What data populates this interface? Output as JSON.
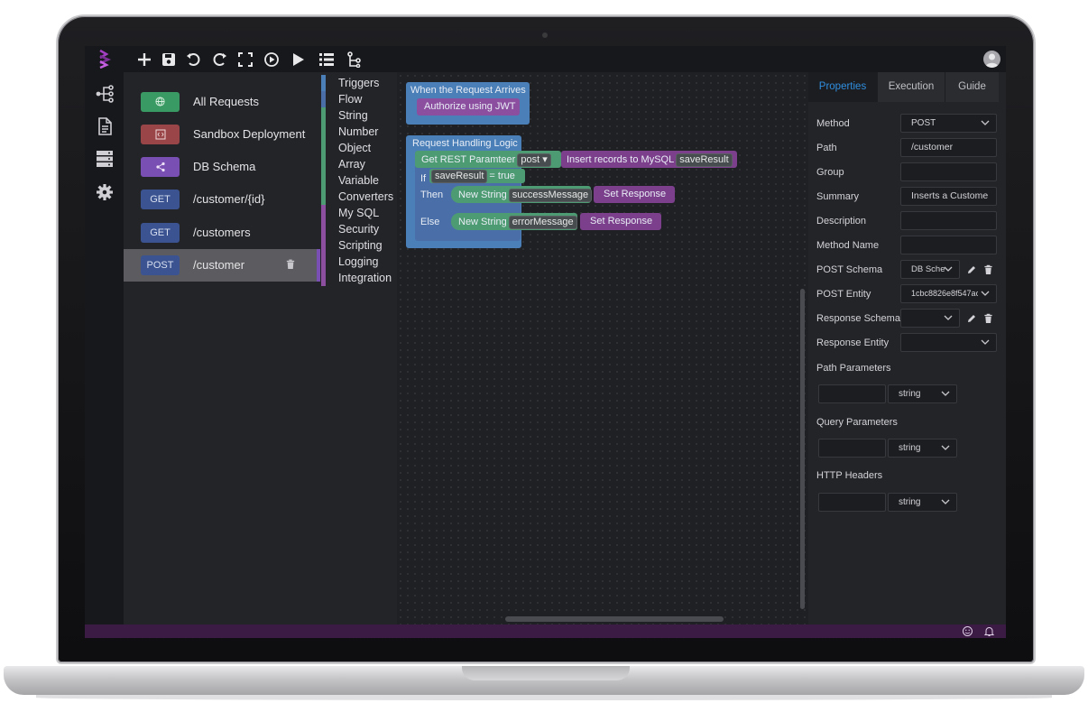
{
  "colors": {
    "accent_blue": "#2f8fe0",
    "status_purple": "#3b1a44",
    "logo_purple": "#a23fc2",
    "badge_green": "#3a9a63",
    "badge_red": "#9a4548",
    "badge_purple": "#7a4fb3",
    "badge_blue": "#3b5491",
    "trigger_block": "#4a7fb8",
    "auth_block": "#8c4fa0",
    "string_block": "#4d9b72",
    "mysql_block": "#7b3f8c"
  },
  "toolbar": {
    "icons": [
      "add-icon",
      "save-icon",
      "undo-icon",
      "redo-icon",
      "fullscreen-icon",
      "debug-run-icon",
      "run-icon",
      "list-icon",
      "flow-icon"
    ]
  },
  "sidebar": {
    "icons": [
      "api-tree-icon",
      "document-icon",
      "database-icon",
      "settings-icon"
    ]
  },
  "requests": {
    "items": [
      {
        "badge": "",
        "badge_icon": "globe-icon",
        "label": "All Requests"
      },
      {
        "badge": "",
        "badge_icon": "code-icon",
        "label": "Sandbox Deployment"
      },
      {
        "badge": "",
        "badge_icon": "share-icon",
        "label": "DB Schema"
      },
      {
        "badge": "GET",
        "label": "/customer/{id}"
      },
      {
        "badge": "GET",
        "label": "/customers"
      },
      {
        "badge": "POST",
        "label": "/customer",
        "active": true
      }
    ]
  },
  "categories": {
    "items": [
      "Triggers",
      "Flow",
      "String",
      "Number",
      "Object",
      "Array",
      "Variable",
      "Converters",
      "My SQL",
      "Security",
      "Scripting",
      "Logging",
      "Integration"
    ]
  },
  "workspace": {
    "trigger_title": "When the Request Arrives",
    "auth_block": "Authorize using JWT",
    "logic_title": "Request Handling Logic",
    "get_param": "Get REST Paramteer",
    "get_param_value": "post",
    "insert_block": "Insert records to MySQL",
    "insert_var": "saveResult",
    "if_label": "If",
    "if_var": "saveResult",
    "if_cond": "= true",
    "then_label": "Then",
    "then_new_string": "New String",
    "then_var": "successMessage",
    "then_set": "Set Response",
    "else_label": "Else",
    "else_new_string": "New String",
    "else_var": "errorMessage",
    "else_set": "Set Response"
  },
  "properties": {
    "tabs": [
      "Properties",
      "Execution",
      "Guide"
    ],
    "active_tab": "Properties",
    "method_label": "Method",
    "method_value": "POST",
    "path_label": "Path",
    "path_value": "/customer",
    "group_label": "Group",
    "group_value": "",
    "summary_label": "Summary",
    "summary_value": "Inserts a Custome",
    "description_label": "Description",
    "description_value": "",
    "method_name_label": "Method Name",
    "method_name_value": "",
    "post_schema_label": "POST Schema",
    "post_schema_value": "DB Sche",
    "post_entity_label": "POST Entity",
    "post_entity_value": "1cbc8826e8f547ac",
    "response_schema_label": "Response Schema",
    "response_schema_value": "",
    "response_entity_label": "Response Entity",
    "response_entity_value": "",
    "path_params_label": "Path Parameters",
    "path_params_type": "string",
    "query_params_label": "Query Parameters",
    "query_params_type": "string",
    "http_headers_label": "HTTP Headers",
    "http_headers_type": "string"
  }
}
